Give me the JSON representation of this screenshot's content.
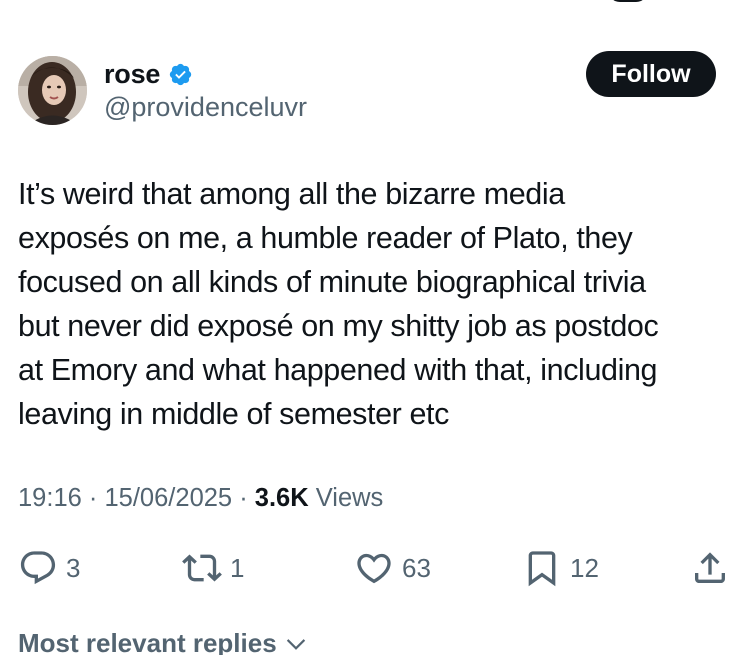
{
  "author": {
    "name": "rose",
    "handle": "@providenceluvr",
    "verified": true
  },
  "follow_button": {
    "label": "Follow"
  },
  "tweet": {
    "lines": [
      "It’s weird that among all the bizarre media",
      "exposés on me, a humble reader of Plato, they",
      "focused on all kinds of minute biographical trivia",
      "but never did exposé on my shitty job as postdoc",
      "at Emory and what happened with that, including",
      "leaving in middle of semester etc"
    ]
  },
  "meta": {
    "time": "19:16",
    "sep1": " · ",
    "date": "15/06/2025",
    "sep2": " · ",
    "views_count": "3.6K",
    "views_label": " Views"
  },
  "actions": {
    "replies": "3",
    "reposts": "1",
    "likes": "63",
    "bookmarks": "12"
  },
  "replies_section": {
    "heading": "Most relevant replies"
  },
  "colors": {
    "text": "#0f1419",
    "secondary": "#536471",
    "verified_blue": "#1d9bf0",
    "button_bg": "#0f1419"
  },
  "icons": {
    "verified": "verified-badge-icon",
    "reply": "speech-bubble-icon",
    "repost": "repost-arrows-icon",
    "like": "heart-icon",
    "bookmark": "bookmark-icon",
    "share": "share-upload-icon",
    "expand": "chevron-down-icon"
  }
}
